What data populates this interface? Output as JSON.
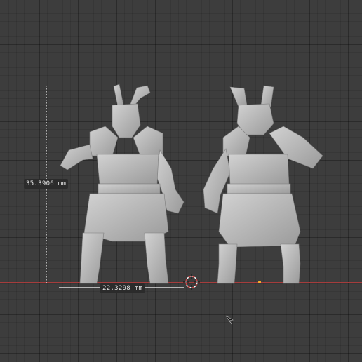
{
  "viewport": {
    "measurements": {
      "height_label": "35.3906 mm",
      "width_label": "22.3298 mm"
    },
    "colors": {
      "background": "#3d3d3d",
      "axis_x": "#a53c3c",
      "axis_y": "#6f9a3b",
      "model": "#b8b8b8"
    },
    "icons": [
      "3d-cursor-icon",
      "origin-point-icon",
      "mouse-pointer-icon"
    ]
  }
}
